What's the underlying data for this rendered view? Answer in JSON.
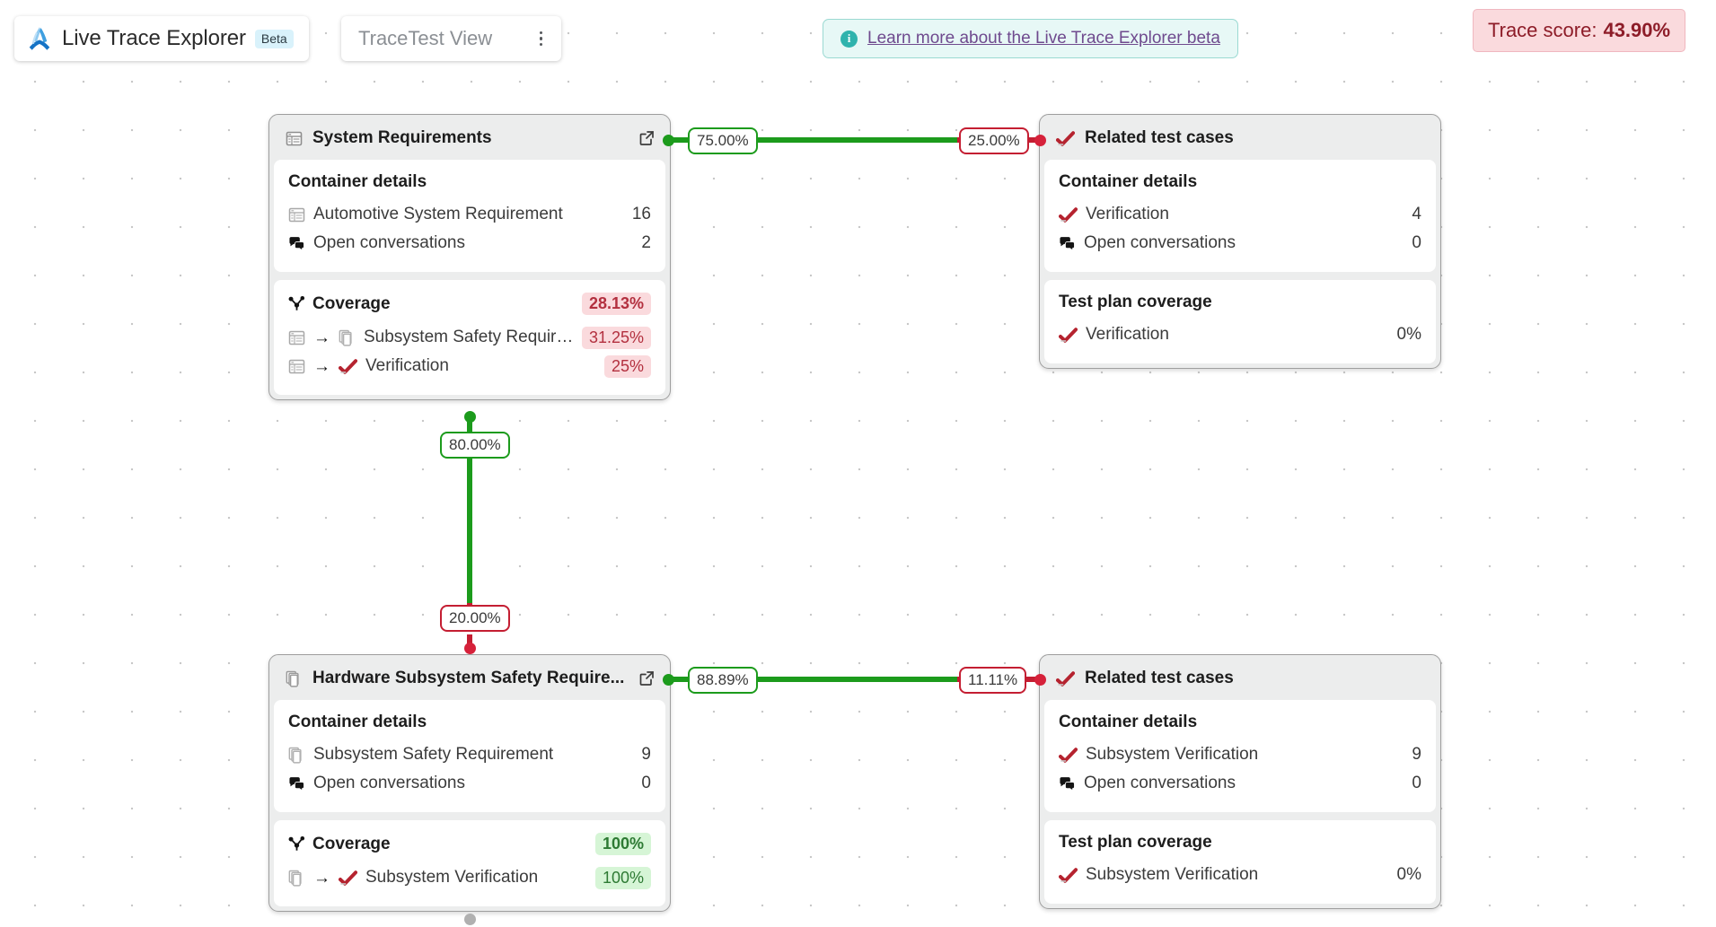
{
  "app": {
    "title": "Live Trace Explorer",
    "beta_badge": "Beta",
    "logo_icon": "live-trace-explorer-logo",
    "accent_blue": "#2f8fdc"
  },
  "view_tab": {
    "label": "TraceTest View",
    "menu_icon": "kebab-menu-icon"
  },
  "beta_banner": {
    "info_icon": "info-circle-icon",
    "link_text": "Learn more about the Live Trace Explorer beta",
    "link_color": "#6f4a8e",
    "background": "#e7f8f6"
  },
  "trace_score": {
    "label": "Trace score:",
    "value": "43.90%",
    "background": "#fadadd",
    "text_color": "#8d1c28"
  },
  "nodes": [
    {
      "id": "system-requirements",
      "title": "System Requirements",
      "title_icon": "requirement-table-icon",
      "open_icon": "external-link-icon",
      "panels": [
        {
          "title": "Container details",
          "title_icon": null,
          "title_pill": null,
          "rows": [
            {
              "icon": "requirement-table-icon",
              "label": "Automotive System Requirement",
              "value": "16"
            },
            {
              "icon": "conversations-icon",
              "label": "Open conversations",
              "value": "2"
            }
          ]
        },
        {
          "title": "Coverage",
          "title_icon": "coverage-branch-icon",
          "title_pill": {
            "text": "28.13%",
            "tone": "red"
          },
          "rows": [
            {
              "icon": "requirement-table-icon",
              "arrow": "→",
              "icon2": "documents-stack-icon",
              "label": "Subsystem Safety Requirem...",
              "pill": {
                "text": "31.25%",
                "tone": "red"
              }
            },
            {
              "icon": "requirement-table-icon",
              "arrow": "→",
              "icon2": "verification-check-icon",
              "label": "Verification",
              "pill": {
                "text": "25%",
                "tone": "red"
              }
            }
          ]
        }
      ]
    },
    {
      "id": "related-test-cases-top",
      "title": "Related test cases",
      "title_icon": "verification-check-icon",
      "open_icon": null,
      "panels": [
        {
          "title": "Container details",
          "title_icon": null,
          "title_pill": null,
          "rows": [
            {
              "icon": "verification-check-icon",
              "label": "Verification",
              "value": "4"
            },
            {
              "icon": "conversations-icon",
              "label": "Open conversations",
              "value": "0"
            }
          ]
        },
        {
          "title": "Test plan coverage",
          "title_icon": null,
          "title_pill": null,
          "rows": [
            {
              "icon": "verification-check-icon",
              "label": "Verification",
              "value": "0%"
            }
          ]
        }
      ]
    },
    {
      "id": "hardware-subsystem-safety-requirements",
      "title": "Hardware Subsystem Safety Require...",
      "title_icon": "documents-stack-icon",
      "open_icon": "external-link-icon",
      "panels": [
        {
          "title": "Container details",
          "title_icon": null,
          "title_pill": null,
          "rows": [
            {
              "icon": "documents-stack-icon",
              "label": "Subsystem Safety Requirement",
              "value": "9"
            },
            {
              "icon": "conversations-icon",
              "label": "Open conversations",
              "value": "0"
            }
          ]
        },
        {
          "title": "Coverage",
          "title_icon": "coverage-branch-icon",
          "title_pill": {
            "text": "100%",
            "tone": "green"
          },
          "rows": [
            {
              "icon": "documents-stack-icon",
              "arrow": "→",
              "icon2": "verification-check-icon",
              "label": "Subsystem Verification",
              "pill": {
                "text": "100%",
                "tone": "green"
              }
            }
          ]
        }
      ]
    },
    {
      "id": "related-test-cases-bottom",
      "title": "Related test cases",
      "title_icon": "verification-check-icon",
      "open_icon": null,
      "panels": [
        {
          "title": "Container details",
          "title_icon": null,
          "title_pill": null,
          "rows": [
            {
              "icon": "verification-check-icon",
              "label": "Subsystem Verification",
              "value": "9"
            },
            {
              "icon": "conversations-icon",
              "label": "Open conversations",
              "value": "0"
            }
          ]
        },
        {
          "title": "Test plan coverage",
          "title_icon": null,
          "title_pill": null,
          "rows": [
            {
              "icon": "verification-check-icon",
              "label": "Subsystem Verification",
              "value": "0%"
            }
          ]
        }
      ]
    }
  ],
  "edges": [
    {
      "id": "edge-sysreq-to-tests-source",
      "label": "75.00%",
      "tone": "green"
    },
    {
      "id": "edge-sysreq-to-tests-target",
      "label": "25.00%",
      "tone": "red"
    },
    {
      "id": "edge-sysreq-to-hw-source",
      "label": "80.00%",
      "tone": "green"
    },
    {
      "id": "edge-sysreq-to-hw-target",
      "label": "20.00%",
      "tone": "red"
    },
    {
      "id": "edge-hw-to-tests-source",
      "label": "88.89%",
      "tone": "green"
    },
    {
      "id": "edge-hw-to-tests-target",
      "label": "11.11%",
      "tone": "red"
    }
  ],
  "colors": {
    "edge_green": "#1c9b1c",
    "edge_red": "#c41e32",
    "node_border": "#9e9e9e",
    "node_header_bg": "#eceded",
    "canvas_bg": "#ffffff",
    "grid_dot": "#c8c8c8"
  }
}
